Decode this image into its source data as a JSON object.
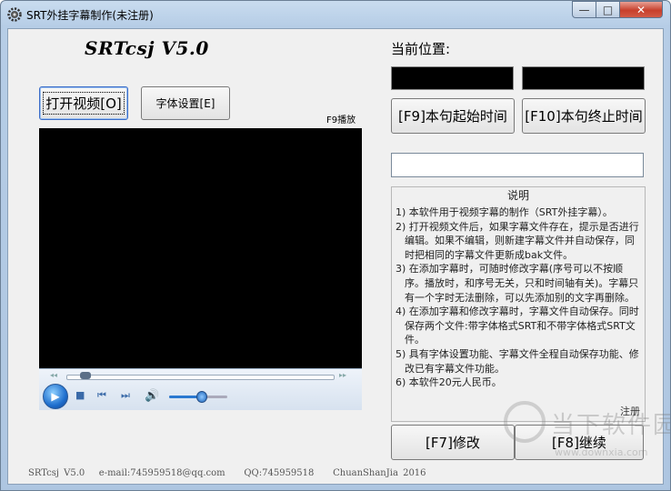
{
  "window": {
    "title": "SRT外挂字幕制作(未注册)",
    "controls": {
      "minimize": "—",
      "maximize": "□",
      "close": "✕"
    }
  },
  "logo": "SRTcsj V5.0",
  "toolbar": {
    "open_video": "打开视频[O]",
    "font_settings": "字体设置[E]",
    "play_hint": "F9播放"
  },
  "position": {
    "label": "当前位置:",
    "start_button": "[F9]本句起始时间",
    "end_button": "[F10]本句终止时间"
  },
  "subtitle_input": {
    "value": ""
  },
  "instructions": {
    "title": "说明",
    "items": [
      "1) 本软件用于视频字幕的制作（SRT外挂字幕）。",
      "2) 打开视频文件后，如果字幕文件存在，提示是否进行编辑。如果不编辑，则新建字幕文件并自动保存，同时把相同的字幕文件更新成bak文件。",
      "3) 在添加字幕时，可随时修改字幕(序号可以不按顺序。播放时，和序号无关，只和时间轴有关)。字幕只有一个字时无法删除，可以先添加别的文字再删除。",
      "4) 在添加字幕和修改字幕时，字幕文件自动保存。同时保存两个文件:带字体格式SRT和不带字体格式SRT文件。",
      "5) 具有字体设置功能、字幕文件全程自动保存功能、修改已有字幕文件功能。",
      "6) 本软件20元人民币。"
    ],
    "footer": "注册"
  },
  "actions": {
    "modify": "[F7]修改",
    "continue": "[F8]继续"
  },
  "footer": {
    "version": "SRTcsj V5.0",
    "email": "e-mail:745959518@qq.com",
    "qq": "QQ:745959518",
    "author": "ChuanShanJia 2016"
  },
  "watermark": {
    "text": "当下软件园",
    "url": "www.downxia.com"
  },
  "player": {
    "volume_level": 0.55,
    "seek_level": 0.05
  }
}
